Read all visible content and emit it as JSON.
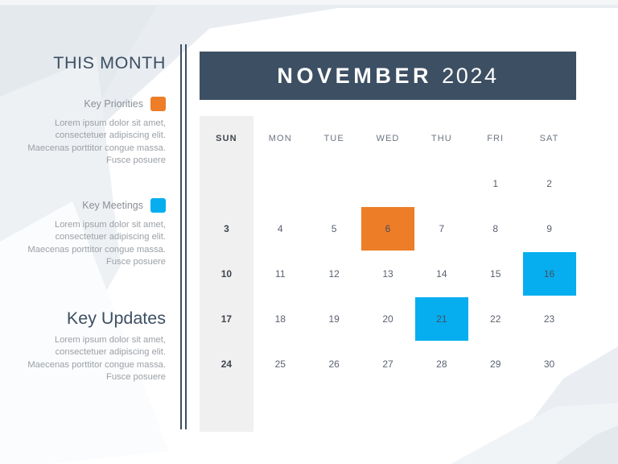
{
  "theme": {
    "dark_navy": "#3d4f63",
    "orange": "#ED7D26",
    "blue": "#06AEEF",
    "sunday_tint": "#f0f0f0",
    "body_text": "#9ba0a6",
    "background": "#ffffff"
  },
  "sidebar": {
    "heading": "THIS MONTH",
    "legend": [
      {
        "title": "Key Priorities",
        "swatch_color": "#ED7D26",
        "body": "Lorem ipsum dolor sit amet, consectetuer adipiscing elit. Maecenas porttitor congue massa. Fusce posuere"
      },
      {
        "title": "Key Meetings",
        "swatch_color": "#06AEEF",
        "body": "Lorem ipsum dolor sit amet, consectetuer adipiscing elit. Maecenas porttitor congue massa. Fusce posuere"
      }
    ],
    "key_updates": {
      "title": "Key Updates",
      "body": "Lorem ipsum dolor sit amet, consectetuer adipiscing elit. Maecenas porttitor congue massa. Fusce posuere"
    }
  },
  "calendar": {
    "month": "NOVEMBER",
    "year": "2024",
    "day_names": [
      "SUN",
      "MON",
      "TUE",
      "WED",
      "THU",
      "FRI",
      "SAT"
    ],
    "weeks": [
      [
        {
          "day": ""
        },
        {
          "day": ""
        },
        {
          "day": ""
        },
        {
          "day": ""
        },
        {
          "day": ""
        },
        {
          "day": "1"
        },
        {
          "day": "2"
        }
      ],
      [
        {
          "day": "3"
        },
        {
          "day": "4"
        },
        {
          "day": "5"
        },
        {
          "day": "6",
          "highlight": "orange"
        },
        {
          "day": "7"
        },
        {
          "day": "8"
        },
        {
          "day": "9"
        }
      ],
      [
        {
          "day": "10"
        },
        {
          "day": "11"
        },
        {
          "day": "12"
        },
        {
          "day": "13"
        },
        {
          "day": "14"
        },
        {
          "day": "15"
        },
        {
          "day": "16",
          "highlight": "blue"
        }
      ],
      [
        {
          "day": "17"
        },
        {
          "day": "18"
        },
        {
          "day": "19"
        },
        {
          "day": "20"
        },
        {
          "day": "21",
          "highlight": "blue"
        },
        {
          "day": "22"
        },
        {
          "day": "23"
        }
      ],
      [
        {
          "day": "24"
        },
        {
          "day": "25"
        },
        {
          "day": "26"
        },
        {
          "day": "27"
        },
        {
          "day": "28"
        },
        {
          "day": "29"
        },
        {
          "day": "30"
        }
      ],
      [
        {
          "day": ""
        },
        {
          "day": ""
        },
        {
          "day": ""
        },
        {
          "day": ""
        },
        {
          "day": ""
        },
        {
          "day": ""
        },
        {
          "day": ""
        }
      ]
    ]
  }
}
